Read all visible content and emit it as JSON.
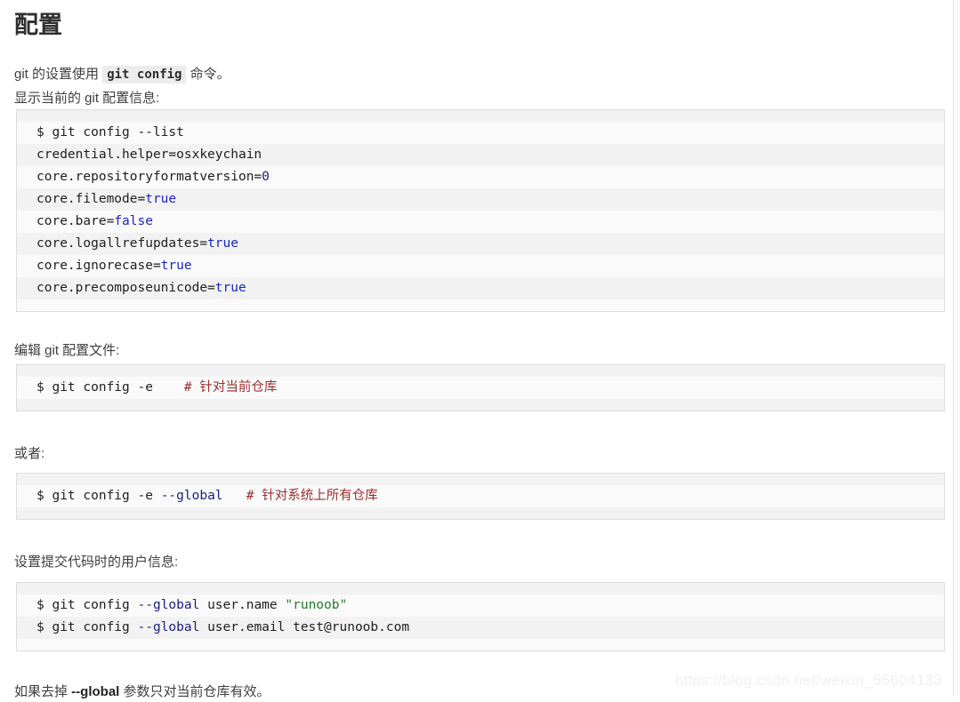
{
  "page": {
    "title": "配置",
    "watermark": "https://blog.csdn.net/weixin_55604133"
  },
  "paragraphs": {
    "intro_before": "git 的设置使用 ",
    "intro_code": "git config",
    "intro_after": " 命令。",
    "show_current": "显示当前的 git 配置信息:",
    "edit_file": "编辑 git 配置文件:",
    "or": "或者:",
    "set_user": "设置提交代码时的用户信息:",
    "footnote_before": "如果去掉 ",
    "footnote_bold": "--global",
    "footnote_after": " 参数只对当前仓库有效。"
  },
  "code_blocks": [
    {
      "name": "git-config-list",
      "lines": [
        [
          {
            "t": "$ git config --list",
            "c": "dark"
          }
        ],
        [
          {
            "t": "credential.helper=osxkeychain",
            "c": "dark"
          }
        ],
        [
          {
            "t": "core.repositoryformatversion=",
            "c": "dark"
          },
          {
            "t": "0",
            "c": "navy"
          }
        ],
        [
          {
            "t": "core.filemode=",
            "c": "dark"
          },
          {
            "t": "true",
            "c": "blue"
          }
        ],
        [
          {
            "t": "core.bare=",
            "c": "dark"
          },
          {
            "t": "false",
            "c": "blue"
          }
        ],
        [
          {
            "t": "core.logallrefupdates=",
            "c": "dark"
          },
          {
            "t": "true",
            "c": "blue"
          }
        ],
        [
          {
            "t": "core.ignorecase=",
            "c": "dark"
          },
          {
            "t": "true",
            "c": "blue"
          }
        ],
        [
          {
            "t": "core.precomposeunicode=",
            "c": "dark"
          },
          {
            "t": "true",
            "c": "blue"
          }
        ]
      ]
    },
    {
      "name": "git-config-e",
      "lines": [
        [
          {
            "t": "$ git config -e    ",
            "c": "dark"
          },
          {
            "t": "# 针对当前仓库",
            "c": "com"
          }
        ]
      ]
    },
    {
      "name": "git-config-e-global",
      "lines": [
        [
          {
            "t": "$ git config -e ",
            "c": "dark"
          },
          {
            "t": "--global",
            "c": "navy"
          },
          {
            "t": "   ",
            "c": "dark"
          },
          {
            "t": "# 针对系统上所有仓库",
            "c": "com"
          }
        ]
      ]
    },
    {
      "name": "git-config-user",
      "lines": [
        [
          {
            "t": "$ git config ",
            "c": "dark"
          },
          {
            "t": "--global",
            "c": "navy"
          },
          {
            "t": " user.name ",
            "c": "dark"
          },
          {
            "t": "\"runoob\"",
            "c": "green"
          }
        ],
        [
          {
            "t": "$ git config ",
            "c": "dark"
          },
          {
            "t": "--global",
            "c": "navy"
          },
          {
            "t": " user.email test@runoob.com",
            "c": "dark"
          }
        ]
      ]
    }
  ],
  "colors": {
    "code_bg": "#fafafa",
    "code_stripe": "#f2f2f2",
    "code_border": "#dddddd",
    "inline_code_bg": "#ececec",
    "text": "#3f3f3f",
    "token_blue": "#1a25c4",
    "token_navy": "#202080",
    "token_green": "#227d2b",
    "token_comment": "#9d2e2e",
    "watermark": "#f0f0f0"
  }
}
